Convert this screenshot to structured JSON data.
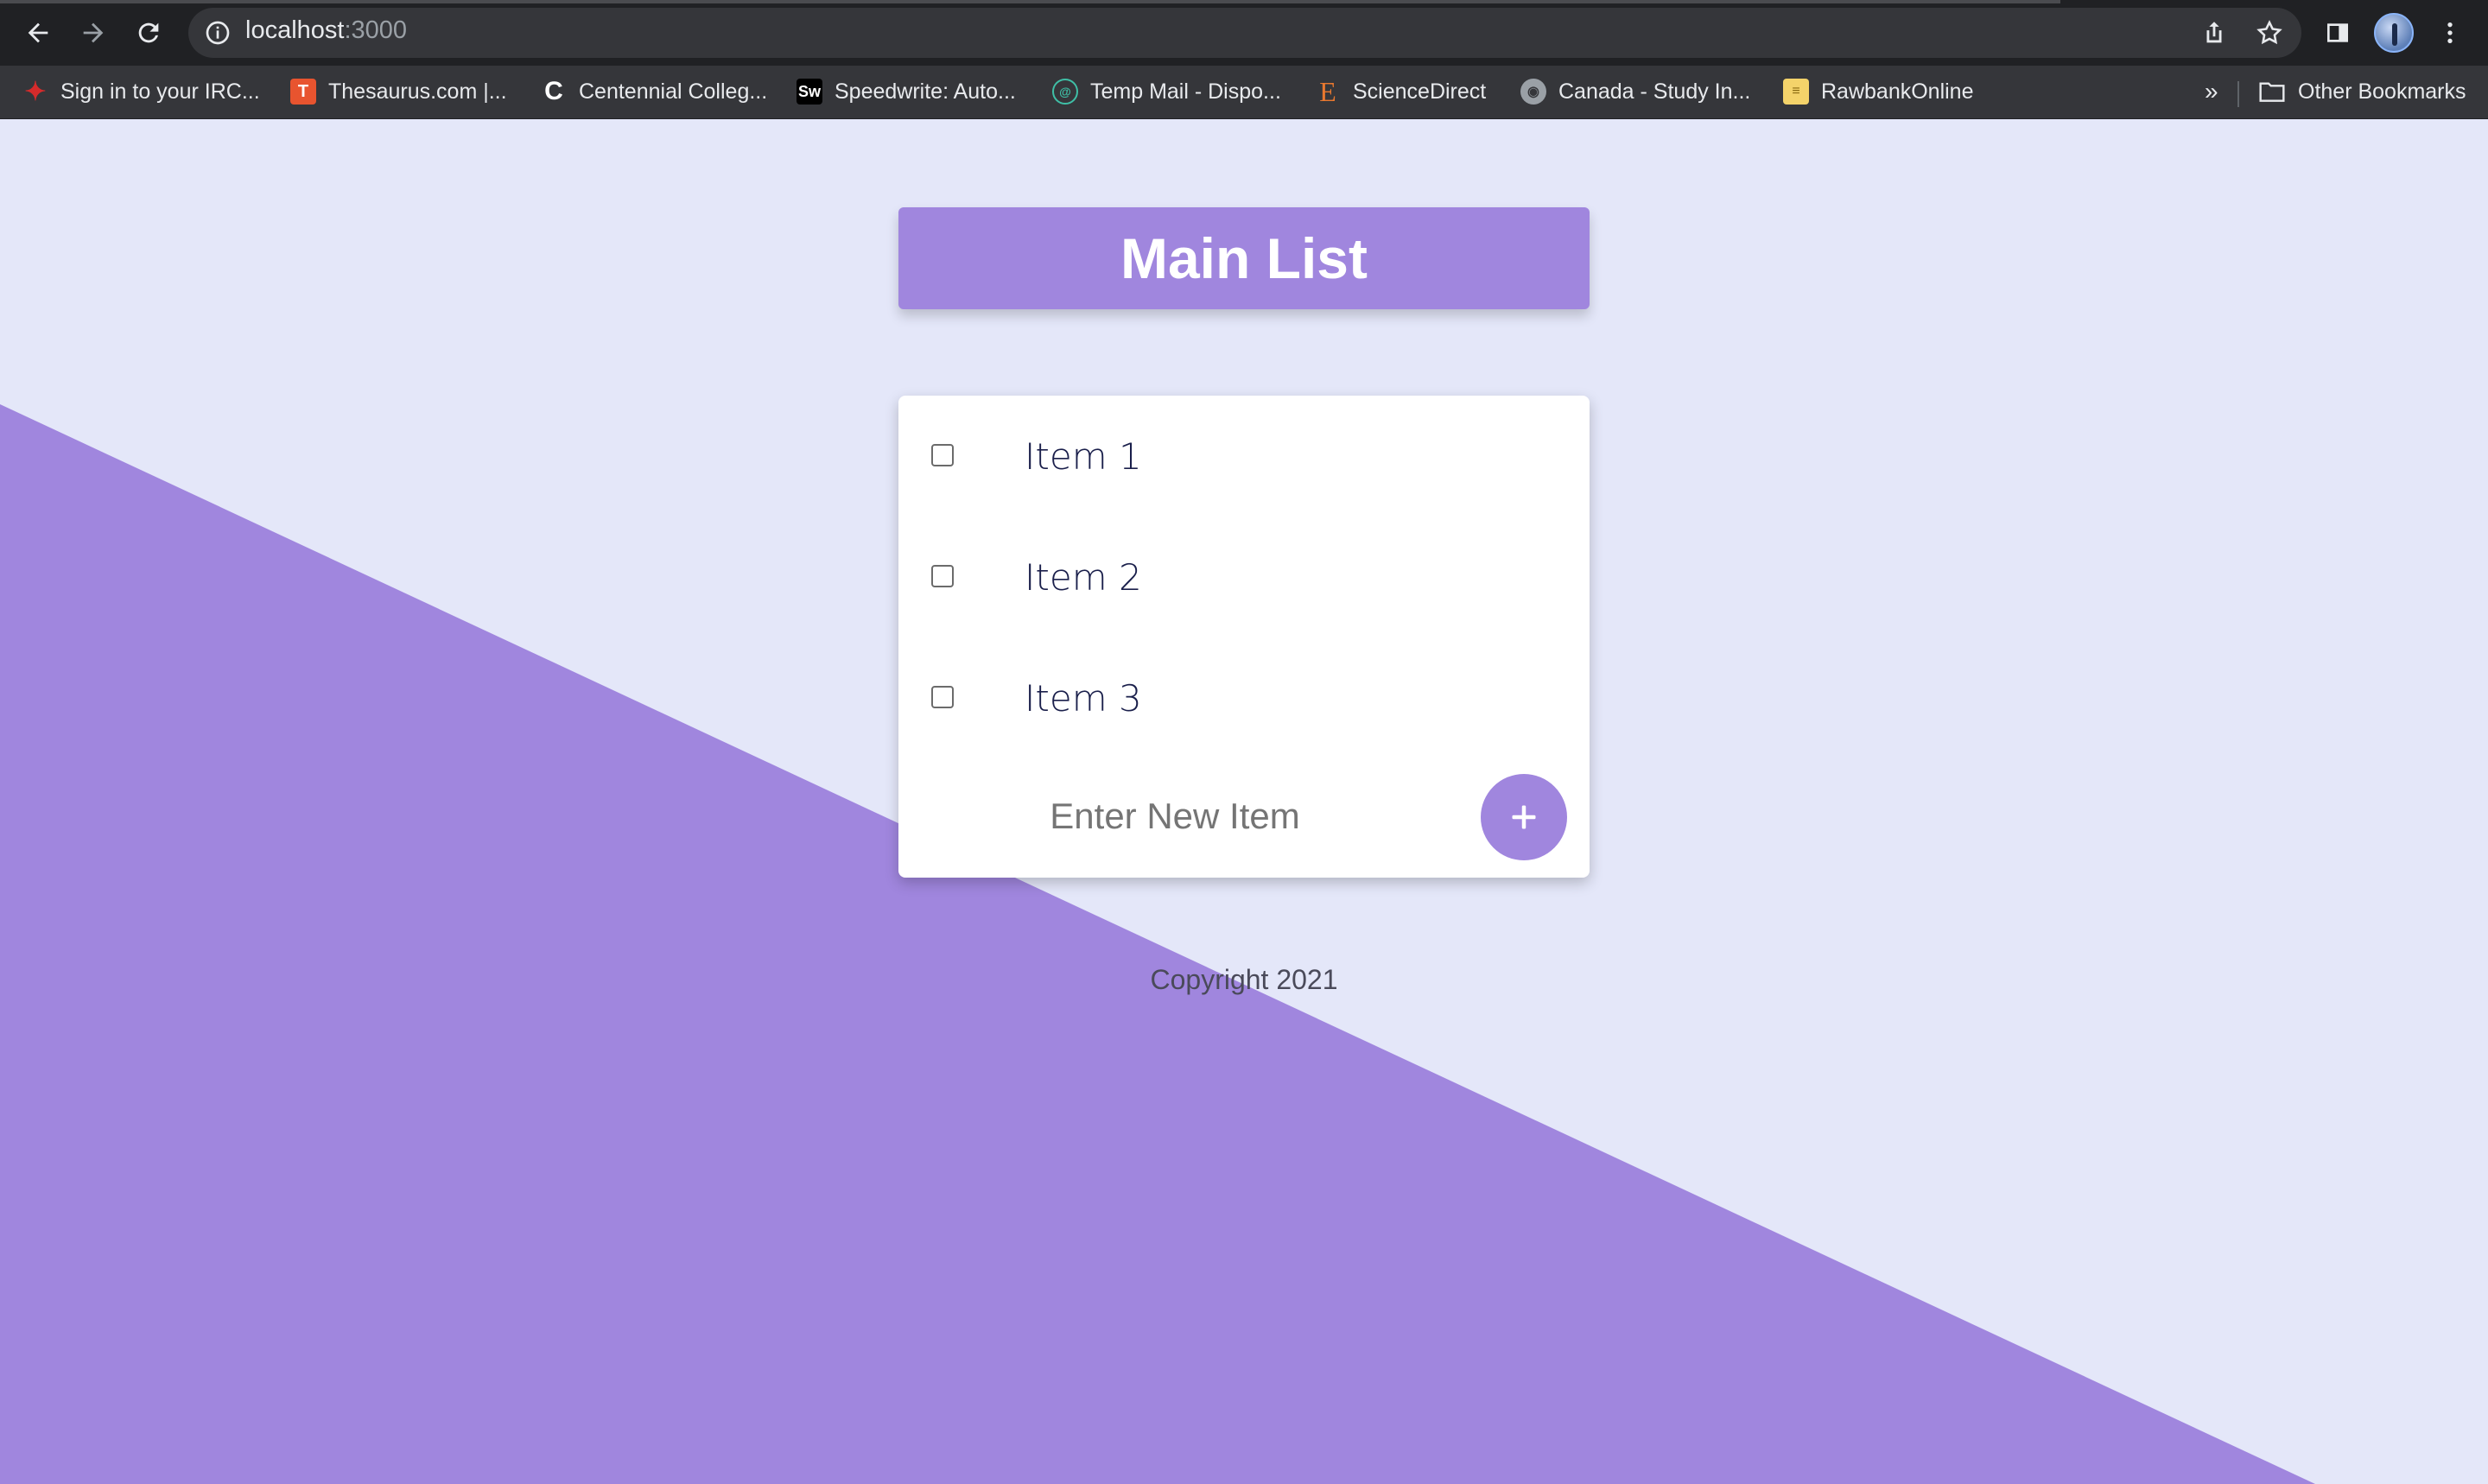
{
  "browser": {
    "url_host": "localhost",
    "url_port": ":3000"
  },
  "bookmarks": [
    {
      "label": "Sign in to your IRC...",
      "icon": "maple-leaf-icon"
    },
    {
      "label": "Thesaurus.com |...",
      "icon": "thesaurus-icon"
    },
    {
      "label": "Centennial Colleg...",
      "icon": "centennial-icon"
    },
    {
      "label": "Speedwrite: Auto...",
      "icon": "speedwrite-icon"
    },
    {
      "label": "Temp Mail - Dispo...",
      "icon": "temp-mail-icon"
    },
    {
      "label": "ScienceDirect",
      "icon": "sciencedirect-icon"
    },
    {
      "label": "Canada - Study In...",
      "icon": "globe-icon"
    },
    {
      "label": "RawbankOnline",
      "icon": "rawbank-icon"
    }
  ],
  "bookmarks_more": "»",
  "other_bookmarks": "Other Bookmarks",
  "app": {
    "title": "Main List",
    "items": [
      {
        "label": "Item 1",
        "checked": false
      },
      {
        "label": "Item 2",
        "checked": false
      },
      {
        "label": "Item 3",
        "checked": false
      }
    ],
    "new_item_placeholder": "Enter New Item",
    "add_button_label": "+",
    "footer": "Copyright 2021"
  },
  "colors": {
    "background": "#e4e7f9",
    "accent": "#a086de",
    "item_text": "#1a1f4b"
  }
}
